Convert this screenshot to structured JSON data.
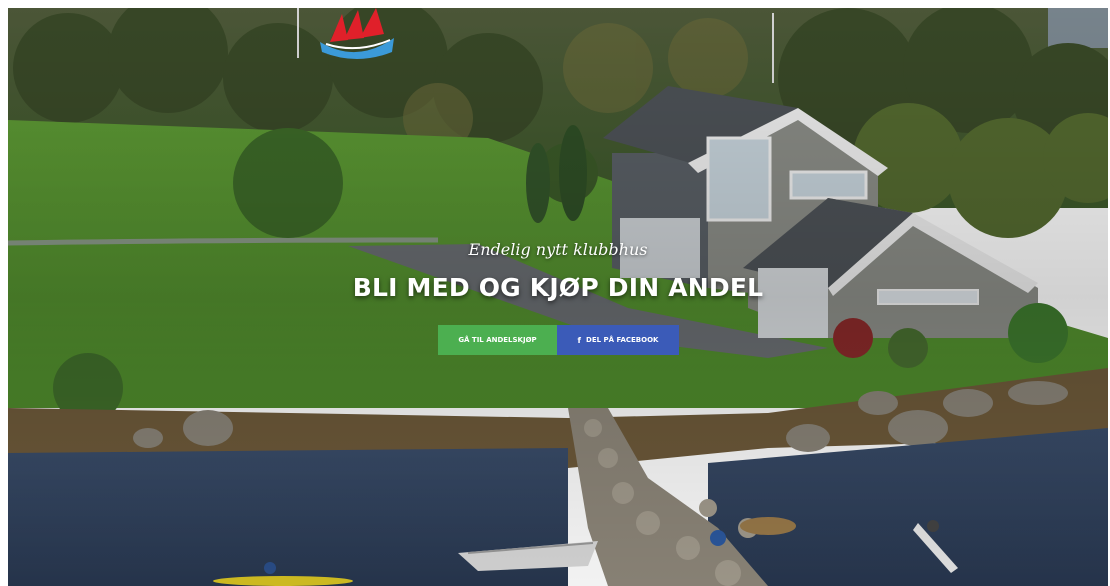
{
  "hero": {
    "subtitle": "Endelig nytt klubbhus",
    "title": "BLI MED OG KJØP DIN ANDEL"
  },
  "buttons": {
    "share_purchase": {
      "label": "GÅ TIL ANDELSKJØP"
    },
    "facebook_share": {
      "icon": "f",
      "label": "DEL PÅ FACEBOOK"
    }
  },
  "logo": {
    "icon": "sailboat-logo"
  },
  "colors": {
    "green_button": "#4caf50",
    "blue_button": "#3b5bb8",
    "logo_red": "#e0202a",
    "logo_blue": "#3b9ad9",
    "text": "#ffffff"
  }
}
